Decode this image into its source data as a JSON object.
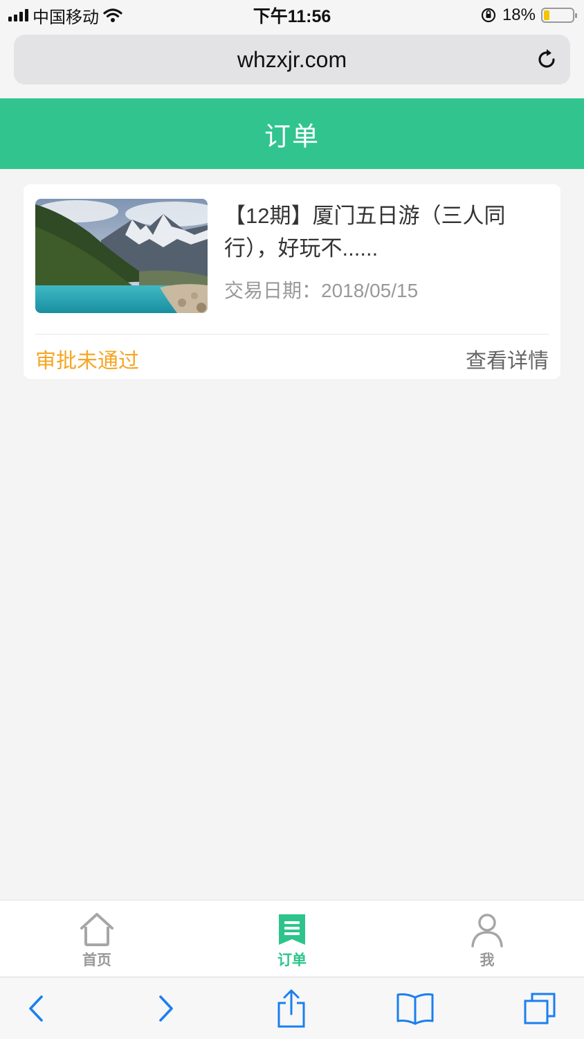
{
  "status_bar": {
    "carrier": "中国移动",
    "time": "下午11:56",
    "battery": "18%",
    "battery_level": 0.18
  },
  "browser": {
    "url": "whzxjr.com",
    "reload_icon": "reload-icon"
  },
  "header": {
    "title": "订单"
  },
  "order": {
    "title": "【12期】厦门五日游（三人同行），好玩不......",
    "date_label": "交易日期：2018/05/15",
    "status": "审批未通过",
    "detail_link": "查看详情",
    "thumbnail": "mountain-lake-photo"
  },
  "tabbar": {
    "items": [
      {
        "label": "首页",
        "icon": "home-icon",
        "active": false
      },
      {
        "label": "订单",
        "icon": "bookmark-list-icon",
        "active": true
      },
      {
        "label": "我",
        "icon": "user-icon",
        "active": false
      }
    ]
  },
  "toolbar": {
    "icons": [
      "back-icon",
      "forward-icon",
      "share-icon",
      "bookmarks-icon",
      "tabs-icon"
    ]
  },
  "colors": {
    "brand_green": "#31c48f",
    "status_orange": "#f5a623",
    "accent_blue": "#1a7ff0"
  }
}
